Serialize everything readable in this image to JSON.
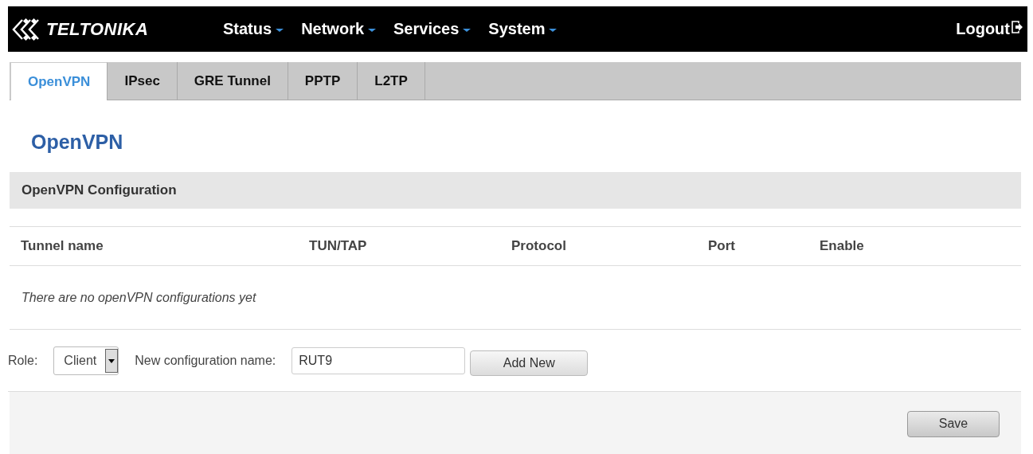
{
  "header": {
    "logo": "TELTONIKA",
    "menu": [
      {
        "label": "Status"
      },
      {
        "label": "Network"
      },
      {
        "label": "Services"
      },
      {
        "label": "System"
      }
    ],
    "logout": "Logout"
  },
  "tabs": [
    {
      "label": "OpenVPN",
      "selected": true
    },
    {
      "label": "IPsec",
      "selected": false
    },
    {
      "label": "GRE Tunnel",
      "selected": false
    },
    {
      "label": "PPTP",
      "selected": false
    },
    {
      "label": "L2TP",
      "selected": false
    }
  ],
  "page_title": "OpenVPN",
  "section": {
    "title": "OpenVPN Configuration",
    "table": {
      "columns": [
        "Tunnel name",
        "TUN/TAP",
        "Protocol",
        "Port",
        "Enable"
      ],
      "empty_message": "There are no openVPN configurations yet"
    }
  },
  "new_config": {
    "role_label": "Role:",
    "role_value": "Client",
    "name_label": "New configuration name:",
    "name_value": "RUT9",
    "add_button": "Add New"
  },
  "footer": {
    "save_button": "Save"
  }
}
